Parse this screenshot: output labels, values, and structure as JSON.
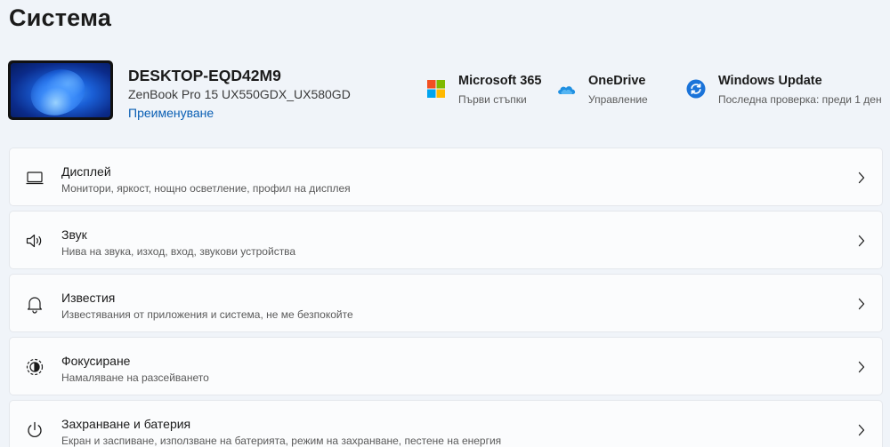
{
  "page": {
    "title": "Система"
  },
  "device": {
    "name": "DESKTOP-EQD42M9",
    "model": "ZenBook Pro 15 UX550GDX_UX580GD",
    "rename_label": "Преименуване"
  },
  "quick_links": [
    {
      "icon": "microsoft-365-icon",
      "title": "Microsoft 365",
      "subtitle": "Първи стъпки"
    },
    {
      "icon": "onedrive-icon",
      "title": "OneDrive",
      "subtitle": "Управление"
    },
    {
      "icon": "windows-update-icon",
      "title": "Windows Update",
      "subtitle": "Последна проверка: преди 1 ден"
    }
  ],
  "settings": [
    {
      "icon": "display-icon",
      "title": "Дисплей",
      "subtitle": "Монитори, яркост, нощно осветление, профил на дисплея"
    },
    {
      "icon": "sound-icon",
      "title": "Звук",
      "subtitle": "Нива на звука, изход, вход, звукови устройства"
    },
    {
      "icon": "notifications-icon",
      "title": "Известия",
      "subtitle": "Известявания от приложения и система, не ме безпокойте"
    },
    {
      "icon": "focus-icon",
      "title": "Фокусиране",
      "subtitle": "Намаляване на разсейването"
    },
    {
      "icon": "power-icon",
      "title": "Захранване и батерия",
      "subtitle": "Екран и заспиване, използване на батерията, режим на захранване, пестене на енергия"
    }
  ],
  "colors": {
    "background": "#f0f4f9",
    "card": "#fbfcfd",
    "link": "#0a5fb4",
    "ms365_red": "#f25022",
    "ms365_green": "#7fba00",
    "ms365_blue": "#00a4ef",
    "ms365_yellow": "#ffb900",
    "onedrive_blue": "#1e8fe1",
    "update_blue": "#1a73d9"
  }
}
